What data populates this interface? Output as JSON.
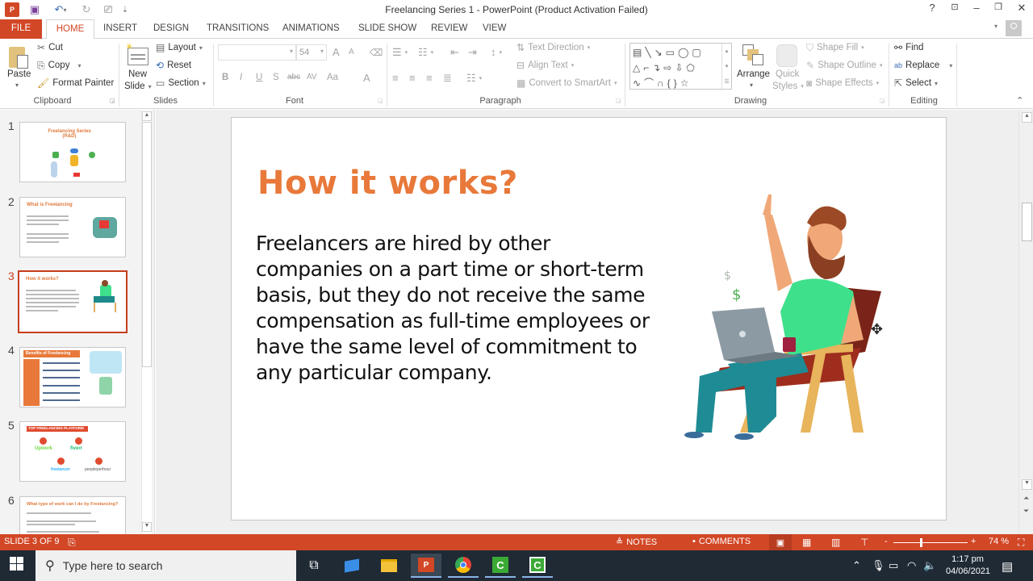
{
  "app": {
    "title": "Freelancing Series 1 - PowerPoint (Product Activation Failed)",
    "window_controls": {
      "help": "?",
      "ribbon_display": "⊡",
      "minimize": "–",
      "restore": "❐",
      "close": "✕"
    }
  },
  "tabs": [
    {
      "label": "FILE"
    },
    {
      "label": "HOME",
      "active": true
    },
    {
      "label": "INSERT"
    },
    {
      "label": "DESIGN"
    },
    {
      "label": "TRANSITIONS"
    },
    {
      "label": "ANIMATIONS"
    },
    {
      "label": "SLIDE SHOW"
    },
    {
      "label": "REVIEW"
    },
    {
      "label": "VIEW"
    }
  ],
  "ribbon": {
    "clipboard": {
      "paste": "Paste",
      "cut": "Cut",
      "copy": "Copy",
      "format_painter": "Format Painter",
      "label": "Clipboard"
    },
    "slides": {
      "new_slide_1": "New",
      "new_slide_2": "Slide",
      "layout": "Layout",
      "reset": "Reset",
      "section": "Section",
      "label": "Slides"
    },
    "font": {
      "font_name": "",
      "font_size": "54",
      "bold": "B",
      "italic": "I",
      "underline": "U",
      "shadow": "S",
      "strike": "abc",
      "spacing": "AV",
      "case": "Aa",
      "color": "A",
      "grow": "A",
      "shrink": "A",
      "label": "Font"
    },
    "paragraph": {
      "text_direction": "Text Direction",
      "align_text": "Align Text",
      "convert_smartart": "Convert to SmartArt",
      "label": "Paragraph"
    },
    "drawing": {
      "arrange": "Arrange",
      "quick_styles_1": "Quick",
      "quick_styles_2": "Styles",
      "shape_fill": "Shape Fill",
      "shape_outline": "Shape Outline",
      "shape_effects": "Shape Effects",
      "label": "Drawing"
    },
    "editing": {
      "find": "Find",
      "replace": "Replace",
      "select": "Select",
      "label": "Editing"
    }
  },
  "thumbnails": [
    {
      "num": "1",
      "title": "Freelancing Series (R&D)"
    },
    {
      "num": "2",
      "title": "What is Freelancing"
    },
    {
      "num": "3",
      "title": "How it works?",
      "selected": true
    },
    {
      "num": "4",
      "title": "Benefits of Freelancing"
    },
    {
      "num": "5",
      "title": "TOP FREELANCING PLATFORM",
      "platforms": [
        "Upwork",
        "fiverr",
        "freelancer",
        "peopleperhour"
      ]
    },
    {
      "num": "6",
      "title": "What type of work can I do by Freelancing?"
    }
  ],
  "slide": {
    "title": "How it works?",
    "body": "Freelancers are hired by other companies on a part time or short-term basis, but they do not receive the same compensation as full-time employees or have the same level of commitment to any particular company.",
    "illustration": "bearded man on chair with laptop and coffee mug, dollar signs"
  },
  "statusbar": {
    "slide_info": "SLIDE 3 OF 9",
    "notes": "NOTES",
    "comments": "COMMENTS",
    "zoom_minus": "-",
    "zoom_plus": "+",
    "zoom_level": "74 %",
    "zoom_fraction": 0.37
  },
  "taskbar": {
    "search_placeholder": "Type here to search",
    "time": "1:17 pm",
    "date": "04/06/2021"
  },
  "colors": {
    "accent": "#d24726",
    "title_orange": "#e8793a",
    "taskbar": "#1f2a35"
  }
}
